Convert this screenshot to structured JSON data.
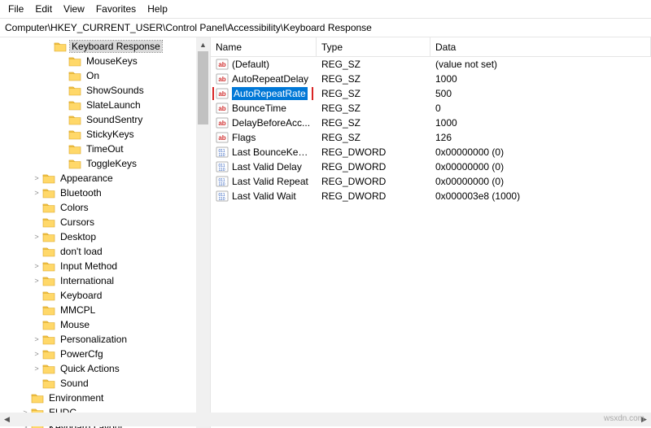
{
  "menu": {
    "file": "File",
    "edit": "Edit",
    "view": "View",
    "favorites": "Favorites",
    "help": "Help"
  },
  "address": "Computer\\HKEY_CURRENT_USER\\Control Panel\\Accessibility\\Keyboard Response",
  "tree": {
    "heading_selected": "Keyboard Response",
    "sub_items": [
      {
        "label": "MouseKeys"
      },
      {
        "label": "On"
      },
      {
        "label": "ShowSounds"
      },
      {
        "label": "SlateLaunch"
      },
      {
        "label": "SoundSentry"
      },
      {
        "label": "StickyKeys"
      },
      {
        "label": "TimeOut"
      },
      {
        "label": "ToggleKeys"
      }
    ],
    "siblings": [
      {
        "label": "Appearance",
        "exp": ">"
      },
      {
        "label": "Bluetooth",
        "exp": ">"
      },
      {
        "label": "Colors",
        "exp": ""
      },
      {
        "label": "Cursors",
        "exp": ""
      },
      {
        "label": "Desktop",
        "exp": ">"
      },
      {
        "label": "don't load",
        "exp": ""
      },
      {
        "label": "Input Method",
        "exp": ">"
      },
      {
        "label": "International",
        "exp": ">"
      },
      {
        "label": "Keyboard",
        "exp": ""
      },
      {
        "label": "MMCPL",
        "exp": ""
      },
      {
        "label": "Mouse",
        "exp": ""
      },
      {
        "label": "Personalization",
        "exp": ">"
      },
      {
        "label": "PowerCfg",
        "exp": ">"
      },
      {
        "label": "Quick Actions",
        "exp": ">"
      },
      {
        "label": "Sound",
        "exp": ""
      }
    ],
    "lower": [
      {
        "label": "Environment",
        "exp": ""
      },
      {
        "label": "EUDC",
        "exp": ">"
      },
      {
        "label": "Keyboard Layout",
        "exp": ">"
      }
    ]
  },
  "columns": {
    "name": "Name",
    "type": "Type",
    "data": "Data"
  },
  "values": [
    {
      "icon": "sz",
      "name": "(Default)",
      "type": "REG_SZ",
      "data": "(value not set)"
    },
    {
      "icon": "sz",
      "name": "AutoRepeatDelay",
      "type": "REG_SZ",
      "data": "1000"
    },
    {
      "icon": "sz",
      "name": "AutoRepeatRate",
      "type": "REG_SZ",
      "data": "500",
      "highlighted": true
    },
    {
      "icon": "sz",
      "name": "BounceTime",
      "type": "REG_SZ",
      "data": "0"
    },
    {
      "icon": "sz",
      "name": "DelayBeforeAcc...",
      "type": "REG_SZ",
      "data": "1000"
    },
    {
      "icon": "sz",
      "name": "Flags",
      "type": "REG_SZ",
      "data": "126"
    },
    {
      "icon": "dw",
      "name": "Last BounceKey ...",
      "type": "REG_DWORD",
      "data": "0x00000000 (0)"
    },
    {
      "icon": "dw",
      "name": "Last Valid Delay",
      "type": "REG_DWORD",
      "data": "0x00000000 (0)"
    },
    {
      "icon": "dw",
      "name": "Last Valid Repeat",
      "type": "REG_DWORD",
      "data": "0x00000000 (0)"
    },
    {
      "icon": "dw",
      "name": "Last Valid Wait",
      "type": "REG_DWORD",
      "data": "0x000003e8 (1000)"
    }
  ],
  "attribution": "wsxdn.com"
}
